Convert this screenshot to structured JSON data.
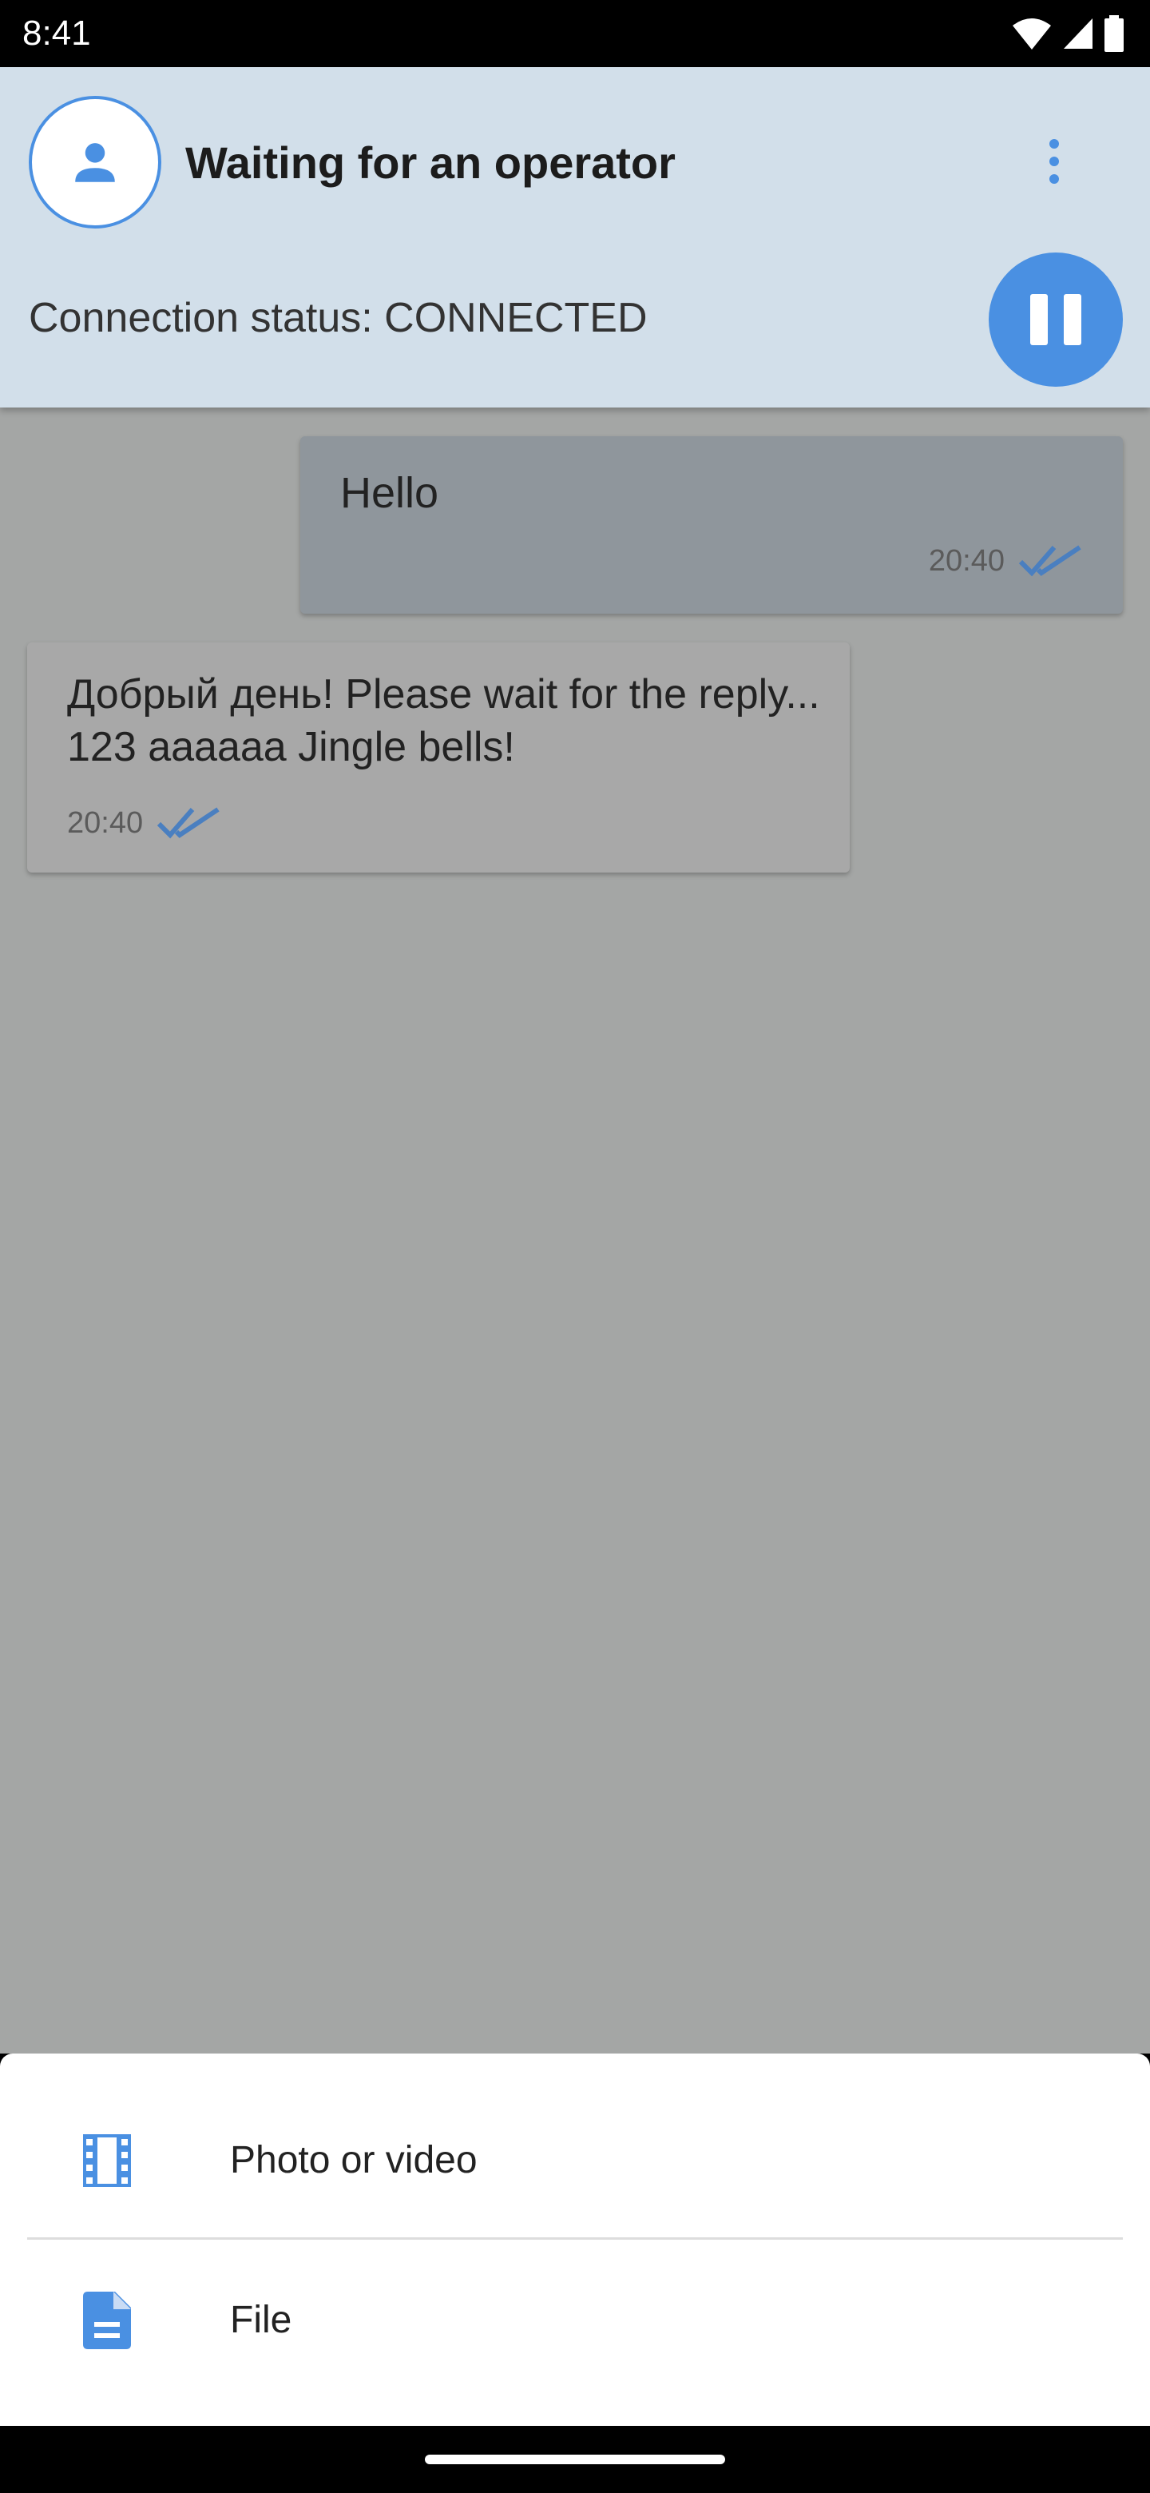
{
  "status_bar": {
    "time": "8:41",
    "icons": [
      "wifi-icon",
      "cellular-signal-icon",
      "battery-icon"
    ]
  },
  "header": {
    "avatar_icon": "person-icon",
    "title": "Waiting for an operator",
    "menu_icon": "more-vertical-icon",
    "connection_status": "Connection status: CONNECTED",
    "pause_icon": "pause-icon"
  },
  "messages": [
    {
      "direction": "outgoing",
      "text": "Hello",
      "time": "20:40",
      "status_icon": "double-check-icon"
    },
    {
      "direction": "incoming",
      "text": "Добрый день! Please wait for the reply... 123 aaaaaa Jingle bells!",
      "time": "20:40",
      "status_icon": "double-check-icon"
    }
  ],
  "attach_sheet": {
    "items": [
      {
        "label": "Photo or video",
        "icon": "film-icon"
      },
      {
        "label": "File",
        "icon": "document-icon"
      }
    ]
  },
  "colors": {
    "accent": "#4a90e2",
    "header_bg": "#d2dfea",
    "chat_overlay_bg": "#a4a6a5",
    "sheet_bg": "#ffffff"
  }
}
